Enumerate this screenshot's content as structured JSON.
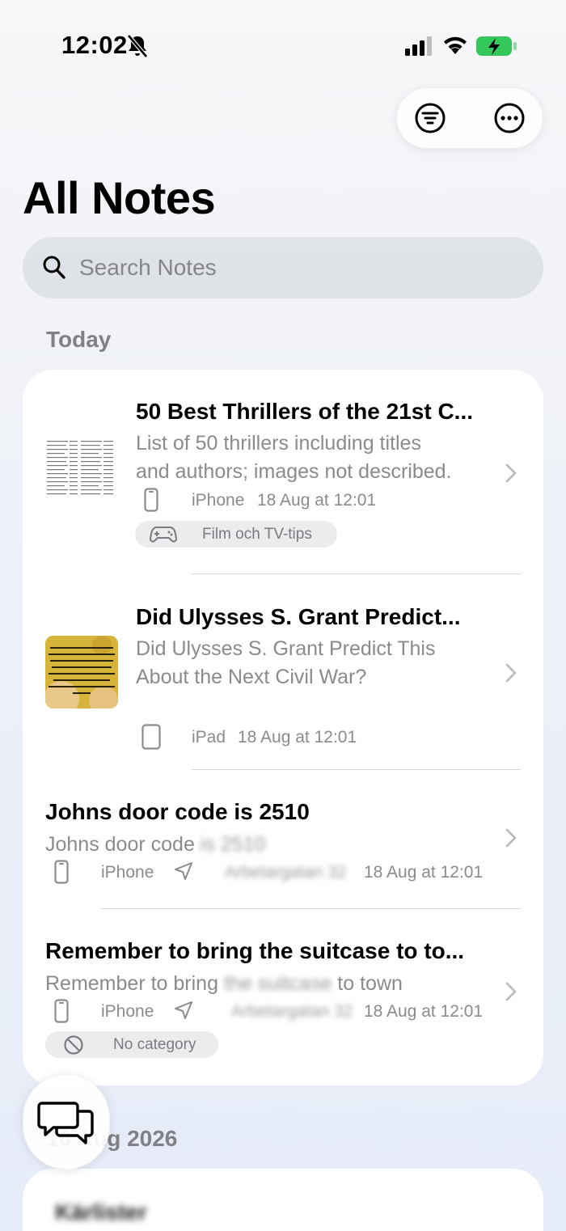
{
  "status_bar": {
    "time": "12:02",
    "icons": [
      "bell-slash-icon",
      "cellular-signal-icon",
      "wifi-icon",
      "battery-charging-icon"
    ]
  },
  "toolbar": {
    "filter_icon": "filter-lines-icon",
    "more_icon": "ellipsis-circle-icon"
  },
  "page": {
    "title": "All Notes"
  },
  "search": {
    "placeholder": "Search Notes"
  },
  "sections": [
    {
      "label": "Today",
      "notes": [
        {
          "title": "50 Best Thrillers of the 21st C...",
          "snippet_line1": "List of 50 thrillers including titles",
          "snippet_line2": "and authors; images not described.",
          "device": "iPhone",
          "date": "18 Aug at 12:01",
          "tag": "Film och TV-tips",
          "tag_icon": "gamecontroller-icon"
        },
        {
          "title": "Did Ulysses S. Grant Predict...",
          "snippet_line1": "Did Ulysses S. Grant Predict This",
          "snippet_line2": "About the Next Civil War?",
          "device": "iPad",
          "date": "18 Aug at 12:01",
          "thumb_text": "If we are to have another contest in the near future of our national existence, I predict that the dividing line will not be Mason and Dixon's but between patriotism and intelligence on the one side, and superstition, ambition and ignorance on the other. — Ulysses S. Grant"
        },
        {
          "title": "Johns door code is 2510",
          "snippet_clear": "Johns door code ",
          "snippet_blurred": "is 2510",
          "device": "iPhone",
          "location": "Arbetargatan 32",
          "date": "18 Aug at 12:01"
        },
        {
          "title": "Remember to bring the suitcase to to...",
          "snippet_clear_a": "Remember to bring ",
          "snippet_blurred": "the suitcase",
          "snippet_clear_b": " to town",
          "device": "iPhone",
          "location": "Arbetargatan 32",
          "date": "18 Aug at 12:01",
          "tag": "No category",
          "tag_icon": "prohibited-icon"
        }
      ]
    },
    {
      "label": "16 Aug 2026",
      "notes": [
        {
          "title": "Kärlister"
        }
      ]
    }
  ],
  "fab": {
    "icon": "chat-bubbles-icon"
  },
  "colors": {
    "accent_battery": "#34c759",
    "secondary_text": "#8a8a8f"
  }
}
